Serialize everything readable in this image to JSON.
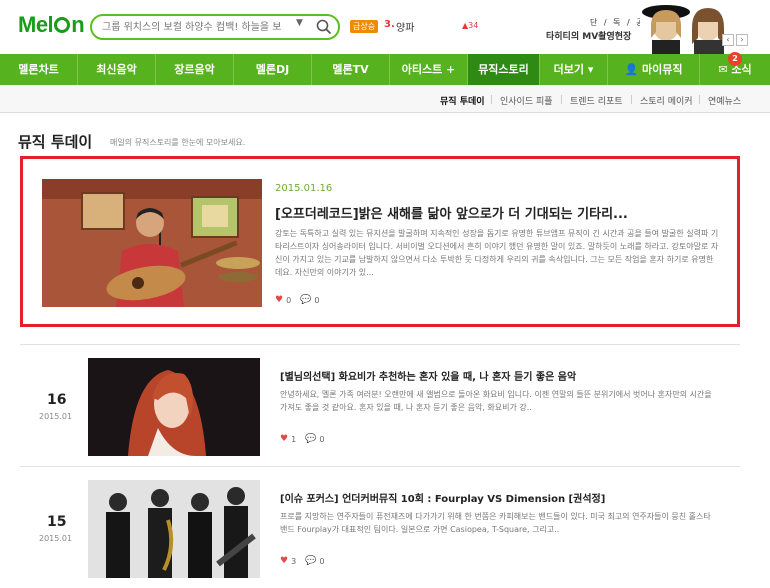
{
  "header": {
    "logo_text": "Melon",
    "search_placeholder": "그룹 위치스의 보컬 하양수 컴백! 하늘을 보네",
    "realtime_badge": "급상승",
    "realtime_rank": "3.",
    "realtime_keyword": "양파",
    "realtime_change": "▲34",
    "promo_small": "단 / 독 / 공 / 개",
    "promo_big": "타히티의 MV촬영현장",
    "promo_prev": "‹",
    "promo_next": "›"
  },
  "gnb": [
    {
      "label": "멜론차트"
    },
    {
      "label": "최신음악"
    },
    {
      "label": "장르음악"
    },
    {
      "label": "멜론DJ"
    },
    {
      "label": "멜론TV"
    },
    {
      "label": "아티스트 +"
    },
    {
      "label": "뮤직스토리"
    },
    {
      "label": "더보기 ▾"
    },
    {
      "label": "👤 마이뮤직"
    },
    {
      "label": "✉ 소식",
      "badge": "2"
    }
  ],
  "lnb": [
    {
      "label": "뮤직 투데이"
    },
    {
      "label": "인사이드 피플"
    },
    {
      "label": "트렌드 리포트"
    },
    {
      "label": "스토리 메이커"
    },
    {
      "label": "연예뉴스"
    }
  ],
  "page": {
    "title": "뮤직 투데이",
    "description": "매일의 뮤직스토리를 한눈에 모아보세요."
  },
  "featured": {
    "date": "2015.01.16",
    "title": "[오프더레코드]밝은 새해를 닮아 앞으로가 더 기대되는 기타리...",
    "body": "강토는 독특하고 실력 있는 뮤지션을 발굴하며 지속적인 성장을 돕기로 유명한 튜브앰프 뮤직이 긴 시간과 공을 들여 발굴한 실력파 기타리스트이자 싱어송라이터 입니다. 서비이벌 오디션에서 흔히 이야기 했던 유명한 말이 있죠. 말하듯이 노래를 하라고. 강토야말로 자신이 가지고 있는 기교를 남발하지 않으면서 다소 투박한 듯 다정하게 우리의 귀를 속삭입니다. 그는 모든 작업을 혼자 하기로 유명한데요. 자신만의 이야기가 있...",
    "likes": "0",
    "comments": "0"
  },
  "stories": [
    {
      "day": "16",
      "year_month": "2015.01",
      "title": "[별님의선택] 화요비가 추천하는 혼자 있을 때, 나 혼자 듣기 좋은 음악",
      "body": "안녕하세요, 멜론 가족 여러분! 오랜만에 새 앨범으로 돌아온 화요비 입니다. 이젠 연말의 들뜬 분위기에서 벗어나 혼자만의 시간을 가져도 좋을 것 같아요. 혼자 있을 때, 나 혼자 듣기 좋은 음악, 화요비가 강..",
      "likes": "1",
      "comments": "0"
    },
    {
      "day": "15",
      "year_month": "2015.01",
      "title": "[이슈 포커스] 언더커버뮤직 10회 : Fourplay VS Dimension [권석정]",
      "body": "프로를 지망하는 연주자들이 퓨전재즈에 다가가기 위해 한 번쯤은 카피해보는 밴드들이 있다. 미국 최고의 연주자들이 뭉친 홀스타 밴드 Fourplay가 대표적인 팀이다. 일본으로 가면 Casiopea, T-Square, 그리고..",
      "likes": "3",
      "comments": "0"
    }
  ]
}
